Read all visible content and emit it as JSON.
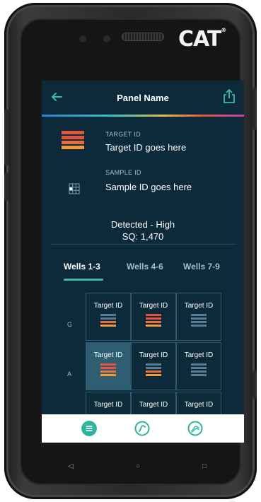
{
  "device": {
    "brand": "CAT"
  },
  "app": {
    "header": {
      "title": "Panel Name"
    },
    "target": {
      "label": "TARGET ID",
      "value": "Target ID goes here"
    },
    "sample": {
      "label": "SAMPLE ID",
      "value": "Sample ID goes here"
    },
    "result": {
      "status": "Detected - High",
      "sq": "SQ: 1,470"
    },
    "tabs": [
      {
        "label": "Wells 1-3",
        "active": true
      },
      {
        "label": "Wells 4-6",
        "active": false
      },
      {
        "label": "Wells 7-9",
        "active": false
      }
    ],
    "grid": {
      "rows": [
        "G",
        "A"
      ],
      "cell_label": "Target ID"
    },
    "bottom_nav": [
      "list-icon",
      "curve-icon",
      "amplification-icon"
    ]
  },
  "softkeys": [
    "◁",
    "○",
    "□"
  ],
  "colors": {
    "screen_bg": "#0d2a3b",
    "accent": "#2fb39f",
    "hot": "#e0553d",
    "warm": "#f19a3a"
  }
}
